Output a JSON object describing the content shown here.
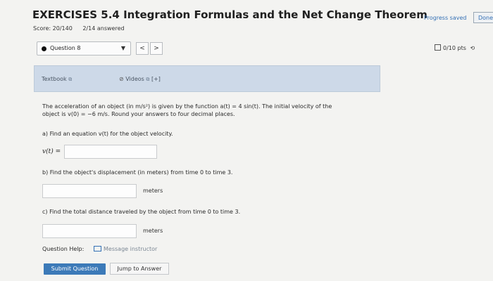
{
  "header": {
    "title": "EXERCISES 5.4 Integration Formulas and the Net Change Theorem",
    "score": "Score: 20/140",
    "answered": "2/14 answered",
    "progress_saved": "Progress saved",
    "done_label": "Done"
  },
  "question_nav": {
    "selected": "Question 8",
    "prev": "<",
    "next": ">",
    "points": "0/10 pts"
  },
  "resources": {
    "textbook": "Textbook",
    "videos": "Videos",
    "videos_extra": "[+]"
  },
  "problem": {
    "line1": "The acceleration of an object (in m/s²) is given by the function a(t) = 4 sin(t). The initial velocity of the",
    "line2": "object is v(0) = −6 m/s. Round your answers to four decimal places.",
    "part_a": "a) Find an equation v(t) for the object velocity.",
    "v_label": "v(t) =",
    "part_b": "b) Find the object's displacement (in meters) from time 0 to time 3.",
    "units_b": "meters",
    "part_c": "c) Find the total distance traveled by the object from time 0 to time 3.",
    "units_c": "meters"
  },
  "footer": {
    "help_label": "Question Help:",
    "message_instructor": "Message instructor",
    "submit": "Submit Question",
    "jump": "Jump to Answer"
  },
  "colors": {
    "accent": "#3c7ab8",
    "resource_bar": "#cdd9e8",
    "background": "#f3f3f1"
  }
}
